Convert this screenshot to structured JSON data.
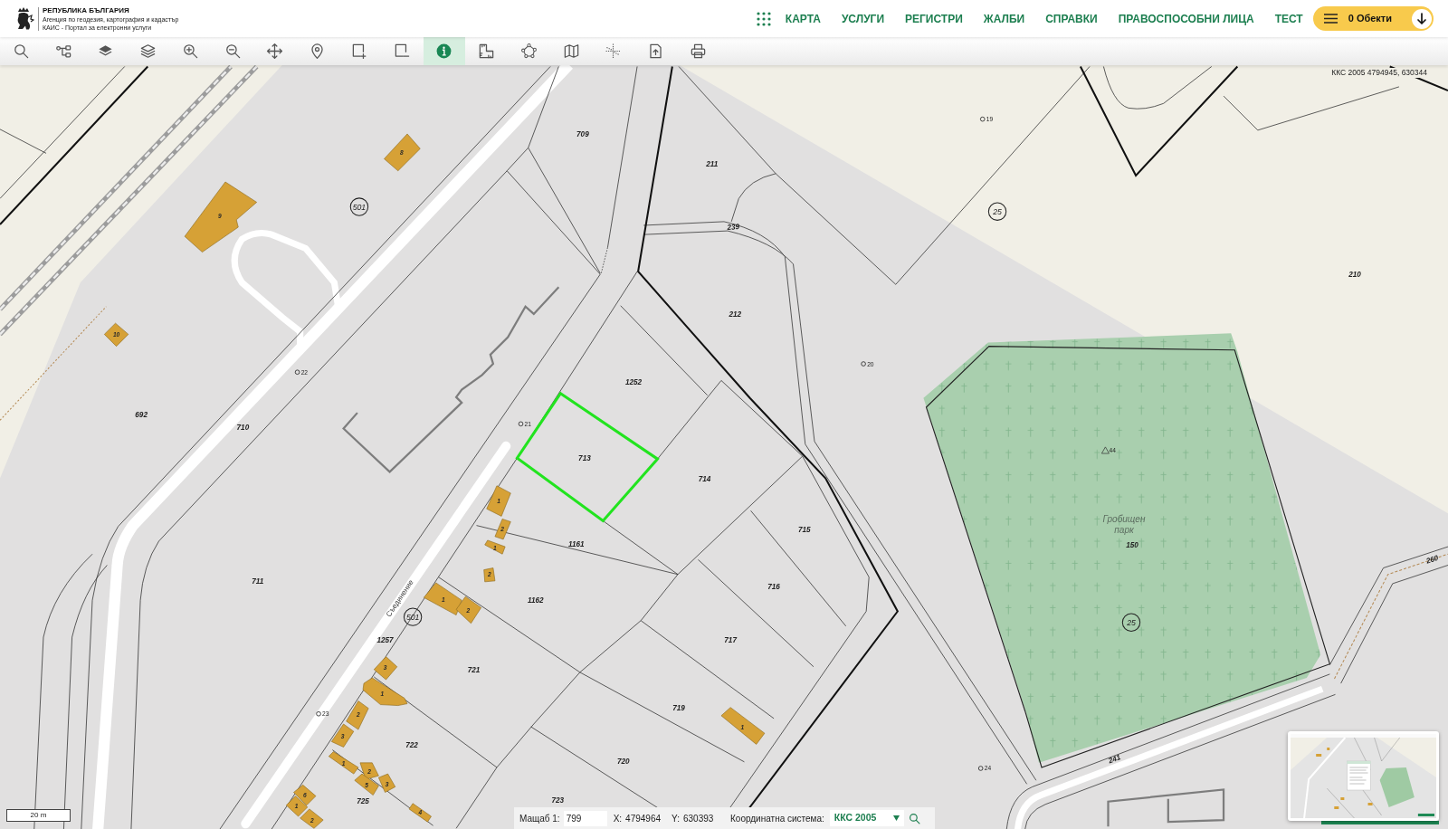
{
  "header": {
    "logo_lines": [
      "РЕПУБЛИКА БЪЛГАРИЯ",
      "Агенция по геодезия, картография и кадастър",
      "КАИС - Портал за електронни услуги"
    ],
    "nav": [
      "КАРТА",
      "УСЛУГИ",
      "РЕГИСТРИ",
      "ЖАЛБИ",
      "СПРАВКИ",
      "ПРАВОСПОСОБНИ ЛИЦА",
      "ТЕСТ"
    ],
    "objects_button": "0 Обекти"
  },
  "toolbar": [
    {
      "selected": false
    },
    {
      "selected": false
    },
    {
      "selected": false
    },
    {
      "selected": false
    },
    {
      "selected": false
    },
    {
      "selected": false
    },
    {
      "selected": false
    },
    {
      "selected": false
    },
    {
      "selected": false
    },
    {
      "selected": false
    },
    {
      "selected": true
    },
    {
      "selected": false
    },
    {
      "selected": false
    },
    {
      "selected": false
    },
    {
      "selected": false
    },
    {
      "selected": false
    },
    {
      "selected": false
    }
  ],
  "map": {
    "crs_readout": "ККС 2005 4794945, 630344",
    "parcels": [
      {
        "number": "709",
        "selected": false
      },
      {
        "number": "211",
        "selected": false
      },
      {
        "number": "239",
        "selected": false
      },
      {
        "number": "210",
        "selected": false
      },
      {
        "number": "212",
        "selected": false
      },
      {
        "number": "1252",
        "selected": false
      },
      {
        "number": "692",
        "selected": false
      },
      {
        "number": "710",
        "selected": false
      },
      {
        "number": "713",
        "selected": true
      },
      {
        "number": "714",
        "selected": false
      },
      {
        "number": "715",
        "selected": false
      },
      {
        "number": "150",
        "selected": false
      },
      {
        "number": "1161",
        "selected": false
      },
      {
        "number": "260",
        "selected": false
      },
      {
        "number": "711",
        "selected": false
      },
      {
        "number": "716",
        "selected": false
      },
      {
        "number": "1162",
        "selected": false
      },
      {
        "number": "1257",
        "selected": false
      },
      {
        "number": "717",
        "selected": false
      },
      {
        "number": "721",
        "selected": false
      },
      {
        "number": "719",
        "selected": false
      },
      {
        "number": "722",
        "selected": false
      },
      {
        "number": "241",
        "selected": false
      },
      {
        "number": "720",
        "selected": false
      },
      {
        "number": "723",
        "selected": false
      },
      {
        "number": "725",
        "selected": false
      }
    ],
    "buildings": [
      "8",
      "9",
      "10",
      "1",
      "2",
      "1",
      "2",
      "1",
      "2",
      "3",
      "1",
      "2",
      "1",
      "3",
      "1",
      "2",
      "3",
      "5",
      "6",
      "1",
      "4",
      "2"
    ],
    "region_numbers": [
      "501",
      "25",
      "501",
      "25"
    ],
    "survey_points": [
      {
        "kind": "circle",
        "label": "19"
      },
      {
        "kind": "circle",
        "label": "20"
      },
      {
        "kind": "circle",
        "label": "22"
      },
      {
        "kind": "circle",
        "label": "21"
      },
      {
        "kind": "triangle",
        "label": "44"
      },
      {
        "kind": "circle",
        "label": "23"
      },
      {
        "kind": "circle",
        "label": "24"
      }
    ],
    "street_name": "Съединение",
    "area_name": "Гробищен парк",
    "scale_bar": "20 m"
  },
  "status_bar": {
    "scale_label": "Мащаб 1:",
    "scale_value": "799",
    "x_label": "X:",
    "x_value": "4794964",
    "y_label": "Y:",
    "y_value": "630393",
    "crs_label": "Координатна система:",
    "crs_value": "ККС 2005"
  }
}
